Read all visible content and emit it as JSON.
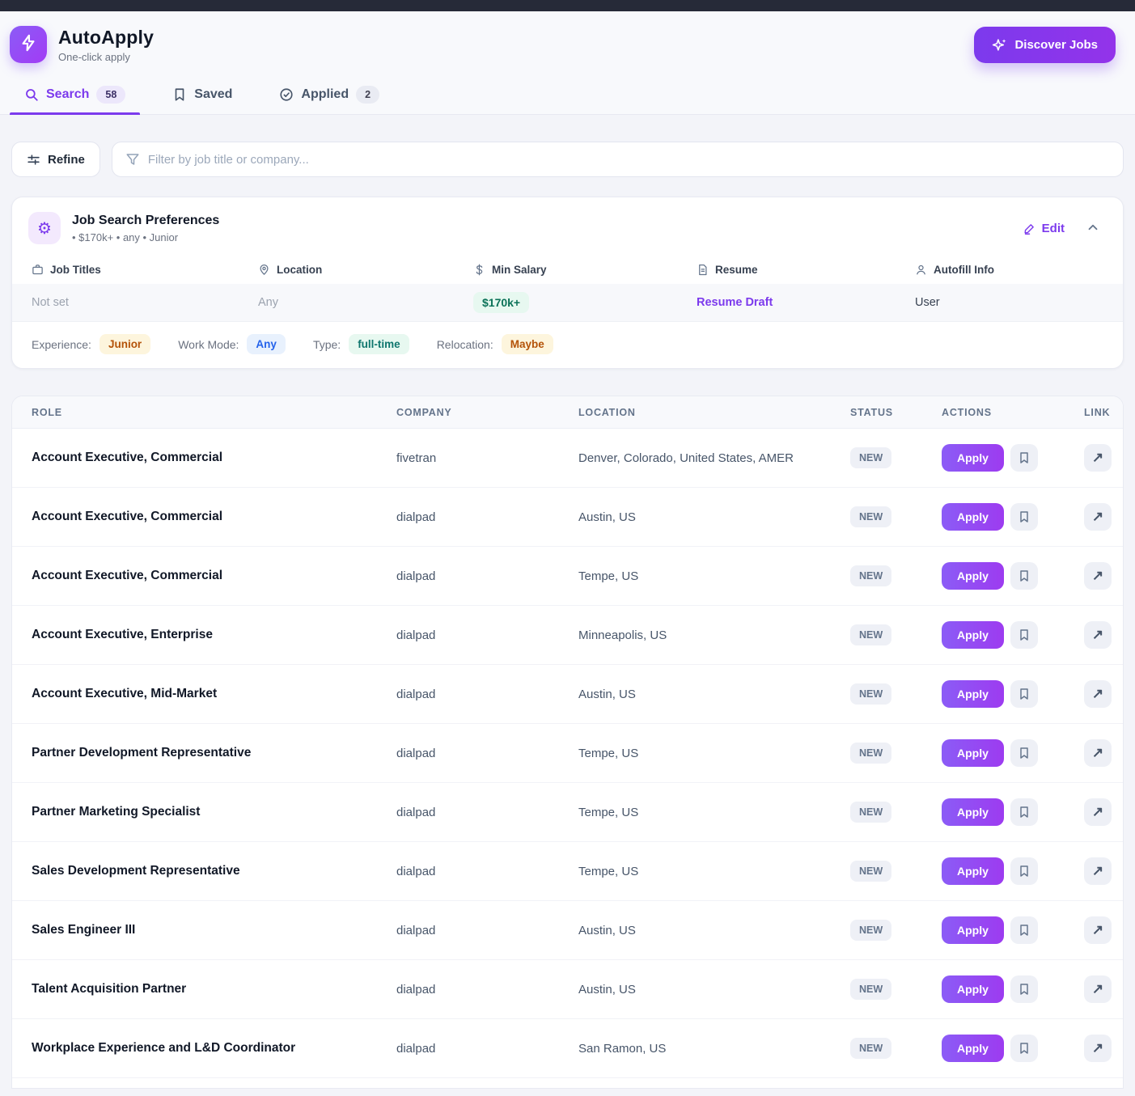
{
  "colors": {
    "accent_purple": "#7c3aed",
    "gradient_start": "#8b5cf6",
    "gradient_end": "#9333ea",
    "topbar": "#262a38",
    "badge_green_text": "#0b7258",
    "badge_green_bg": "#e7f8f0",
    "status_badge_bg": "#eef0f6"
  },
  "app": {
    "name": "AutoApply",
    "tagline": "One-click apply",
    "discover_button": "Discover Jobs"
  },
  "tabs": [
    {
      "label": "Search",
      "count": "58",
      "active": true
    },
    {
      "label": "Saved"
    },
    {
      "label": "Applied",
      "count": "2"
    }
  ],
  "filter": {
    "refine_label": "Refine",
    "placeholder": "Filter by job title or company..."
  },
  "preferences": {
    "title": "Job Search Preferences",
    "summary": "• $170k+ • any • Junior",
    "edit_label": "Edit",
    "fields": [
      {
        "icon": "briefcase-icon",
        "label": "Job Titles",
        "value": "Not set"
      },
      {
        "icon": "location-pin-icon",
        "label": "Location",
        "value": "Any"
      },
      {
        "icon": "dollar-icon",
        "label": "Min Salary",
        "value": "$170k+"
      },
      {
        "icon": "document-icon",
        "label": "Resume",
        "value": "Resume Draft"
      },
      {
        "icon": "person-icon",
        "label": "Autofill Info",
        "value": "User"
      }
    ],
    "meta": [
      {
        "label": "Experience:",
        "value": "Junior",
        "color": "amber"
      },
      {
        "label": "Work Mode:",
        "value": "Any",
        "color": "blue"
      },
      {
        "label": "Type:",
        "value": "full-time",
        "color": "teal"
      },
      {
        "label": "Relocation:",
        "value": "Maybe",
        "color": "amber"
      }
    ]
  },
  "table": {
    "columns": [
      "ROLE",
      "COMPANY",
      "LOCATION",
      "STATUS",
      "ACTIONS",
      "LINK"
    ],
    "apply_label": "Apply",
    "rows": [
      {
        "role": "Account Executive, Commercial",
        "company": "fivetran",
        "location": "Denver, Colorado, United States, AMER",
        "status": "NEW"
      },
      {
        "role": "Account Executive, Commercial",
        "company": "dialpad",
        "location": "Austin, US",
        "status": "NEW"
      },
      {
        "role": "Account Executive, Commercial",
        "company": "dialpad",
        "location": "Tempe, US",
        "status": "NEW"
      },
      {
        "role": "Account Executive, Enterprise",
        "company": "dialpad",
        "location": "Minneapolis, US",
        "status": "NEW"
      },
      {
        "role": "Account Executive, Mid-Market",
        "company": "dialpad",
        "location": "Austin, US",
        "status": "NEW"
      },
      {
        "role": "Partner Development Representative",
        "company": "dialpad",
        "location": "Tempe, US",
        "status": "NEW"
      },
      {
        "role": "Partner Marketing Specialist",
        "company": "dialpad",
        "location": "Tempe, US",
        "status": "NEW"
      },
      {
        "role": "Sales Development Representative",
        "company": "dialpad",
        "location": "Tempe, US",
        "status": "NEW"
      },
      {
        "role": "Sales Engineer III",
        "company": "dialpad",
        "location": "Austin, US",
        "status": "NEW"
      },
      {
        "role": "Talent Acquisition Partner",
        "company": "dialpad",
        "location": "Austin, US",
        "status": "NEW"
      },
      {
        "role": "Workplace Experience and L&D Coordinator",
        "company": "dialpad",
        "location": "San Ramon, US",
        "status": "NEW"
      }
    ]
  }
}
